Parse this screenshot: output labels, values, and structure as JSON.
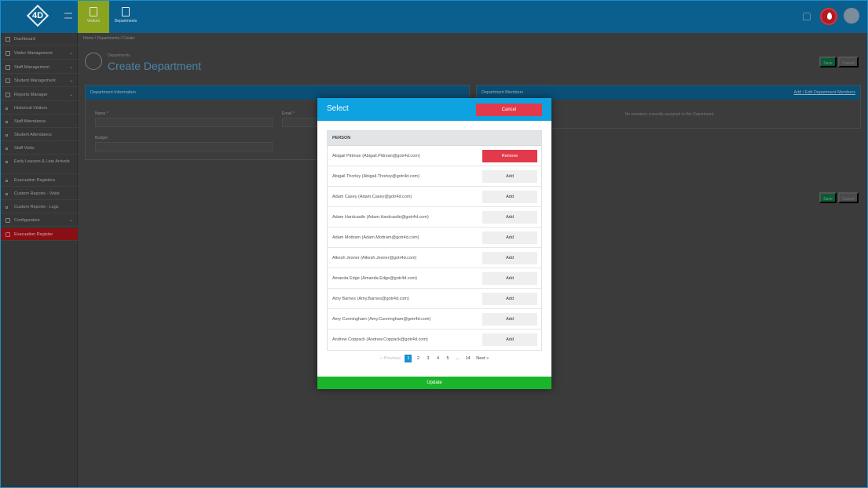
{
  "topbar": {
    "logo_text": "4D",
    "tabs": [
      {
        "label": "Visitors"
      },
      {
        "label": "Departments"
      }
    ],
    "icons": [
      "bell-icon",
      "alert-icon",
      "user-avatar-icon"
    ]
  },
  "sidebar": {
    "items": [
      {
        "label": "Dashboard"
      },
      {
        "label": "Visitor Management"
      },
      {
        "label": "Staff Management"
      },
      {
        "label": "Student Management"
      },
      {
        "label": "Reports Manager"
      },
      {
        "label": "Historical Visitors"
      },
      {
        "label": "Staff Attendance"
      },
      {
        "label": "Student Attendance"
      },
      {
        "label": "Staff Visits"
      },
      {
        "label": "Early Leavers & Late Arrivals"
      },
      {
        "label": "Evacuation Registers"
      },
      {
        "label": "Custom Reports - Visits"
      },
      {
        "label": "Custom Reports - Logs"
      },
      {
        "label": "Configuration"
      },
      {
        "label": "Evacuation Register"
      }
    ]
  },
  "main": {
    "breadcrumb": "Home  /  Departments  /  Create",
    "page_subtitle": "Departments",
    "page_title": "Create Department",
    "save_label": "Save",
    "cancel_label": "Cancel",
    "info_panel": {
      "title": "Department Information",
      "name_label": "Name *",
      "email_label": "Email *",
      "budget_label": "Budget"
    },
    "members_panel": {
      "title": "Department Members",
      "link": "Add / Edit Department Members",
      "empty_message": "No members currently assigned to this Department"
    }
  },
  "modal": {
    "title": "Select",
    "cancel_label": "Cancel",
    "column_header": "PERSON",
    "rows": [
      {
        "name": "Abigail Pittman (Abigail.Pittman@gotr4d.com)",
        "action": "Remove"
      },
      {
        "name": "Abigail Thorley (Abigail.Thorley@gotr4d.com)",
        "action": "Add"
      },
      {
        "name": "Adam Casey (Adam.Casey@gotr4d.com)",
        "action": "Add"
      },
      {
        "name": "Adam Hardcastle (Adam.Hardcastle@gotr4d.com)",
        "action": "Add"
      },
      {
        "name": "Adam Mottram (Adam.Mottram@gotr4d.com)",
        "action": "Add"
      },
      {
        "name": "Alkesh Jesner (Alkesh.Jesner@gotr4d.com)",
        "action": "Add"
      },
      {
        "name": "Amanda Edge (Amanda.Edge@gotr4d.com)",
        "action": "Add"
      },
      {
        "name": "Amy Barnes (Amy.Barnes@gotr4d.com)",
        "action": "Add"
      },
      {
        "name": "Amy Cunningham (Amy.Cunningham@gotr4d.com)",
        "action": "Add"
      },
      {
        "name": "Andrew Coppack (Andrew.Coppack@gotr4d.com)",
        "action": "Add"
      }
    ],
    "pagination": {
      "previous": "« Previous",
      "pages": [
        "1",
        "2",
        "3",
        "4",
        "5",
        "...",
        "14"
      ],
      "current": "1",
      "next": "Next »"
    },
    "update_label": "Update"
  },
  "colors": {
    "modal_header": "#0ea2e0",
    "danger": "#e23a4b",
    "success": "#19b52b",
    "topbar": "#0b5f8f"
  }
}
